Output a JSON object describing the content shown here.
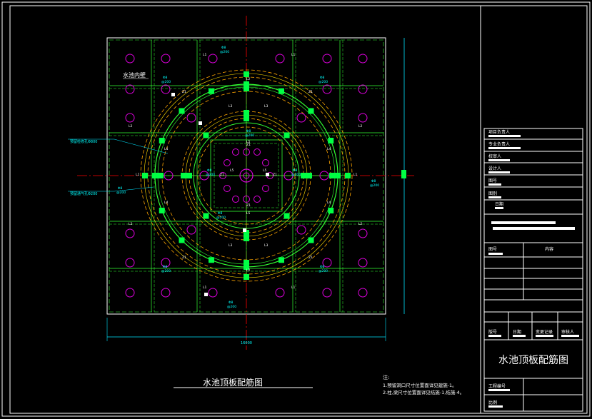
{
  "drawing": {
    "title": "水池顶板配筋图",
    "inner_wall_label": "水池内壁",
    "dimension_total": "16000",
    "left_callouts": [
      "预留检修孔Φ800",
      "预留通气孔Φ200"
    ],
    "notes_heading": "注:",
    "notes": [
      "1.预留洞口尺寸位置面详见建施-1。",
      "2.柱,梁尺寸位置面详见结施-1,结施-4。"
    ],
    "beam_labels": [
      "L1",
      "L2",
      "L3",
      "L4",
      "L5"
    ],
    "column_label": "Z1",
    "rebar_label": "Φ8",
    "rebar_spacing": "@200"
  },
  "title_block": {
    "rows": [
      "项目负责人",
      "专业负责人",
      "校审人",
      "设计人",
      "图号",
      "图别",
      "日期"
    ],
    "table_headers": [
      "图号",
      "内容"
    ],
    "revision_headers": [
      "版号",
      "日期",
      "变更记录",
      "审核人"
    ],
    "drawing_name": "水池顶板配筋图",
    "project_no_label": "工程编号",
    "scale_label": "比例"
  },
  "colors": {
    "background": "#000000",
    "frame": "#ffffff",
    "grid": "#ff0000",
    "beam": "#33ff33",
    "wall_ring": "#ffa500",
    "column": "#00ff44",
    "opening": "#dd00dd",
    "annotation": "#00ffff",
    "dimension": "#00e5ff"
  }
}
